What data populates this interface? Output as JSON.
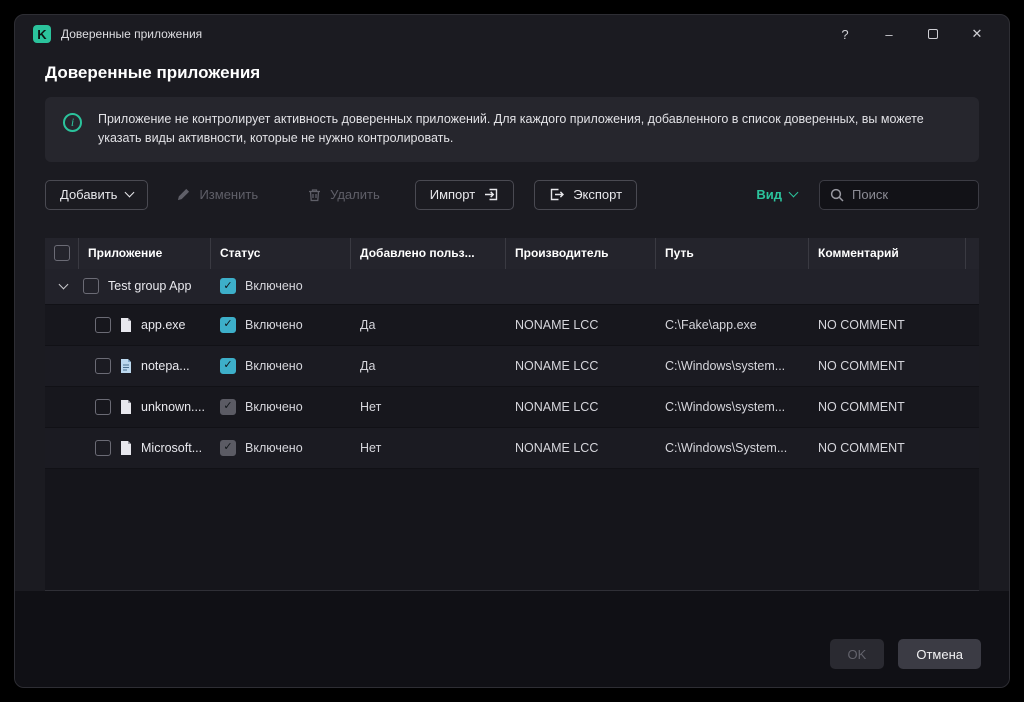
{
  "colors": {
    "accent": "#2bc39c",
    "checkbox": "#3dafc9"
  },
  "window": {
    "title": "Доверенные приложения",
    "icons": {
      "help": "?",
      "minimize": "–",
      "close": "✕"
    }
  },
  "page": {
    "title": "Доверенные приложения"
  },
  "banner": {
    "text": "Приложение не контролирует активность доверенных приложений. Для каждого приложения, добавленного в список доверенных, вы можете указать виды активности, которые не нужно контролировать."
  },
  "toolbar": {
    "add_label": "Добавить",
    "edit_label": "Изменить",
    "delete_label": "Удалить",
    "import_label": "Импорт",
    "export_label": "Экспорт",
    "view_label": "Вид",
    "search_placeholder": "Поиск"
  },
  "table": {
    "headers": {
      "application": "Приложение",
      "status": "Статус",
      "added_by_user": "Добавлено польз...",
      "vendor": "Производитель",
      "path": "Путь",
      "comment": "Комментарий"
    },
    "group": {
      "name": "Test group App",
      "status": "Включено",
      "status_checked": true
    },
    "rows": [
      {
        "name": "app.exe",
        "status": "Включено",
        "status_checked": true,
        "status_disabled": false,
        "added": "Да",
        "vendor": "NONAME LCC",
        "path": "C:\\Fake\\app.exe",
        "comment": "NO COMMENT"
      },
      {
        "name": "notepa...",
        "status": "Включено",
        "status_checked": true,
        "status_disabled": false,
        "added": "Да",
        "vendor": "NONAME LCC",
        "path": "C:\\Windows\\system...",
        "comment": "NO COMMENT"
      },
      {
        "name": "unknown....",
        "status": "Включено",
        "status_checked": true,
        "status_disabled": true,
        "added": "Нет",
        "vendor": "NONAME LCC",
        "path": "C:\\Windows\\system...",
        "comment": "NO COMMENT"
      },
      {
        "name": "Microsoft...",
        "status": "Включено",
        "status_checked": true,
        "status_disabled": true,
        "added": "Нет",
        "vendor": "NONAME LCC",
        "path": "C:\\Windows\\System...",
        "comment": "NO COMMENT"
      }
    ]
  },
  "footer": {
    "ok_label": "OK",
    "cancel_label": "Отмена"
  }
}
